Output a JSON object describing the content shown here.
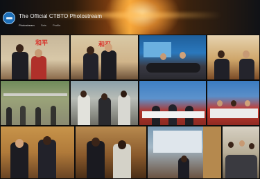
{
  "header": {
    "title": "The Official CTBTO Photostream",
    "nav": [
      "Photostream",
      "Sets",
      "Profile"
    ],
    "logo_icon": "ctbto-logo-icon"
  },
  "colors": {
    "header_glow": "#f0a83a",
    "background": "#121212",
    "banner_text": "#d8322a"
  },
  "photos": [
    {
      "name": "photo-1"
    },
    {
      "name": "photo-2"
    },
    {
      "name": "photo-3"
    },
    {
      "name": "photo-4"
    },
    {
      "name": "photo-5"
    },
    {
      "name": "photo-6"
    },
    {
      "name": "photo-7"
    },
    {
      "name": "photo-8"
    },
    {
      "name": "photo-9"
    },
    {
      "name": "photo-10"
    },
    {
      "name": "photo-11"
    },
    {
      "name": "photo-12"
    },
    {
      "name": "photo-13"
    }
  ]
}
